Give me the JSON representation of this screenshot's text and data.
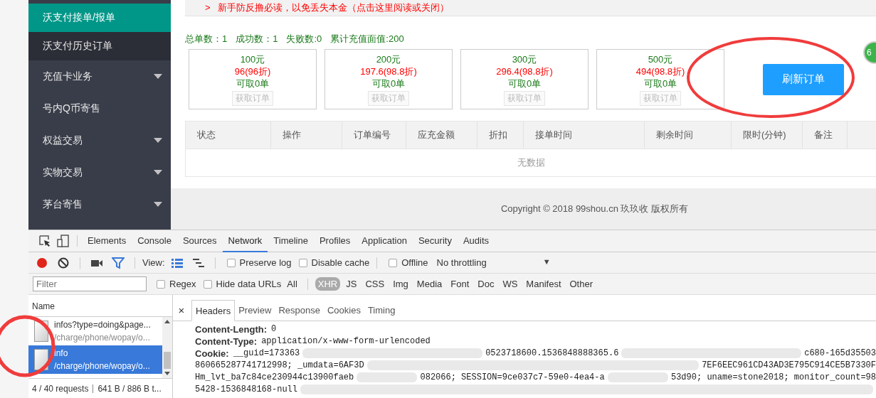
{
  "sidebar": {
    "items": [
      {
        "label": "沃支付接单/报单",
        "kind": "child",
        "selected": true,
        "expandable": false
      },
      {
        "label": "沃支付历史订单",
        "kind": "child",
        "selected": false,
        "expandable": false
      },
      {
        "label": "充值卡业务",
        "kind": "top",
        "selected": false,
        "expandable": true
      },
      {
        "label": "号内Q币寄售",
        "kind": "top",
        "selected": false,
        "expandable": false
      },
      {
        "label": "权益交易",
        "kind": "top",
        "selected": false,
        "expandable": true
      },
      {
        "label": "实物交易",
        "kind": "top",
        "selected": false,
        "expandable": true
      },
      {
        "label": "茅台寄售",
        "kind": "top",
        "selected": false,
        "expandable": true
      }
    ]
  },
  "notice": {
    "marker": ">",
    "text": "新手防反撸必读，以免丢失本金（点击这里阅读或关闭）"
  },
  "stats": [
    "总单数：1",
    "成功数：1",
    "失败数:0",
    "累计充值面值:200"
  ],
  "cards": [
    {
      "face": "100元",
      "price": "96(96折)",
      "available": "可取0单",
      "button": "获取订单",
      "disabled": true
    },
    {
      "face": "200元",
      "price": "197.6(98.8折)",
      "available": "可取0单",
      "button": "获取订单",
      "disabled": true
    },
    {
      "face": "300元",
      "price": "296.4(98.8折)",
      "available": "可取0单",
      "button": "获取订单",
      "disabled": true
    },
    {
      "face": "500元",
      "price": "494(98.8折)",
      "available": "可取0单",
      "button": "获取订单",
      "disabled": true
    }
  ],
  "refresh_button": "刷新订单",
  "floating_badge": "6",
  "table": {
    "columns": [
      "状态",
      "操作",
      "订单编号",
      "应充金额",
      "折扣",
      "接单时间",
      "剩余时间",
      "限时(分钟)",
      "备注"
    ],
    "empty_text": "无数据"
  },
  "footer": "Copyright © 2018 99shou.cn 玖玖收 版权所有",
  "devtools": {
    "tabs": [
      {
        "label": "Elements",
        "selected": false
      },
      {
        "label": "Console",
        "selected": false
      },
      {
        "label": "Sources",
        "selected": false
      },
      {
        "label": "Network",
        "selected": true
      },
      {
        "label": "Timeline",
        "selected": false
      },
      {
        "label": "Profiles",
        "selected": false
      },
      {
        "label": "Application",
        "selected": false
      },
      {
        "label": "Security",
        "selected": false
      },
      {
        "label": "Audits",
        "selected": false
      }
    ],
    "view_label": "View:",
    "options": [
      {
        "label": "Preserve log",
        "checked": false
      },
      {
        "label": "Disable cache",
        "checked": false
      }
    ],
    "offline": {
      "label": "Offline",
      "checked": false
    },
    "throttling": {
      "value": "No throttling",
      "caret": "▼"
    },
    "filter": {
      "placeholder": "Filter"
    },
    "filter_options": [
      {
        "label": "Regex",
        "checked": false
      },
      {
        "label": "Hide data URLs",
        "checked": false
      }
    ],
    "types": [
      {
        "label": "All",
        "selected": false
      },
      {
        "label": "XHR",
        "selected": true
      },
      {
        "label": "JS",
        "selected": false
      },
      {
        "label": "CSS",
        "selected": false
      },
      {
        "label": "Img",
        "selected": false
      },
      {
        "label": "Media",
        "selected": false
      },
      {
        "label": "Font",
        "selected": false
      },
      {
        "label": "Doc",
        "selected": false
      },
      {
        "label": "WS",
        "selected": false
      },
      {
        "label": "Manifest",
        "selected": false
      },
      {
        "label": "Other",
        "selected": false
      }
    ],
    "name_header": "Name",
    "requests": [
      {
        "name": "infos?type=doing&page...",
        "path": "/charge/phone/wopay/o...",
        "selected": false
      },
      {
        "name": "info",
        "path": "/charge/phone/wopay/o...",
        "selected": true
      }
    ],
    "summary": [
      "4 / 40 requests",
      "641 B / 886 B t..."
    ],
    "close": "×",
    "detail_tabs": [
      {
        "label": "Headers",
        "selected": true
      },
      {
        "label": "Preview",
        "selected": false
      },
      {
        "label": "Response",
        "selected": false
      },
      {
        "label": "Cookies",
        "selected": false
      },
      {
        "label": "Timing",
        "selected": false
      }
    ],
    "headers": [
      {
        "kind": "plain",
        "name": "Content-Length:",
        "value": "0"
      },
      {
        "kind": "plain",
        "name": "Content-Type:",
        "value": "application/x-www-form-urlencoded"
      },
      {
        "kind": "redacted",
        "name": "Cookie:",
        "lines": [
          [
            "__guid=173363",
            "0523718600.1536848888365.6",
            "c680-165d35503"
          ],
          [
            "860665287741712998; _umdata=6AF3D",
            "7EF6EEC961CD43AD3E795C914CE5B7330F"
          ],
          [
            "Hm_lvt_ba7c84ce230944c13900faeb",
            "082066; SESSION=9ce037c7-59e0-4ea4-a",
            "53d90; uname=stone2018; monitor_count=98"
          ],
          [
            "5428-1536848168-null"
          ]
        ]
      }
    ]
  }
}
